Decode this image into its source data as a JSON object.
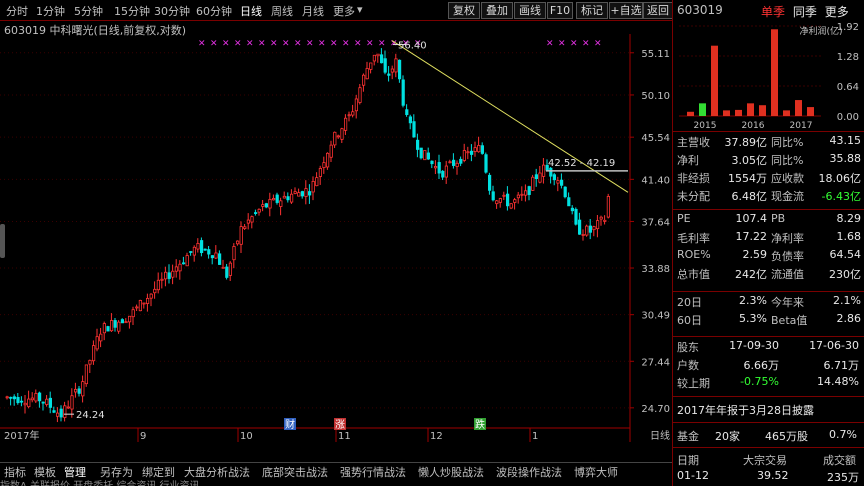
{
  "toolbar": {
    "periods": [
      "分时",
      "1分钟",
      "5分钟",
      "15分钟",
      "30分钟",
      "60分钟",
      "日线",
      "周线",
      "月线",
      "更多"
    ],
    "active_period": "日线",
    "buttons": [
      "复权",
      "叠加",
      "画线",
      "F10",
      "标记",
      "+自选",
      "返回"
    ]
  },
  "stock": {
    "title": "603019 中科曙光(日线,前复权,对数)"
  },
  "chart": {
    "y_labels": [
      "55.11",
      "50.10",
      "45.54",
      "41.40",
      "37.64",
      "33.88",
      "30.49",
      "27.44",
      "24.70"
    ],
    "x_labels": [
      "2017年",
      "9",
      "10",
      "11",
      "12",
      "1"
    ],
    "annotations": {
      "high": "56.40",
      "low": "24.24",
      "range": "42.52 - 42.19"
    },
    "markers": [
      {
        "text": "财",
        "color": "#3060c0"
      },
      {
        "text": "涨",
        "color": "#c03030"
      },
      {
        "text": "跌",
        "color": "#30a030"
      }
    ],
    "corner_label": "日线",
    "up_color": "#ff3232",
    "down_color": "#00e0e0",
    "trend_color": "#e0e060"
  },
  "bottom_tabs": [
    "指标",
    "模板",
    "管理",
    "另存为",
    "绑定到",
    "大盘分析战法",
    "底部突击战法",
    "强势行情战法",
    "懒人炒股战法",
    "波段操作战法",
    "博弈大师"
  ],
  "active_tab": "管理",
  "bottom_row2": "指数A 关联报价 开盘委托 综合资讯 行业资讯",
  "panel": {
    "code": "603019",
    "tabs": [
      "单季",
      "同季",
      "更多"
    ],
    "legend": "净利润(亿)",
    "bar_y": [
      "1.92",
      "1.28",
      "0.64",
      "0.00"
    ],
    "years": [
      "2015",
      "2016",
      "2017"
    ],
    "bars": [
      {
        "v": 0.09,
        "c": "#e03020"
      },
      {
        "v": 0.27,
        "c": "#33dd33"
      },
      {
        "v": 1.5,
        "c": "#e03020"
      },
      {
        "v": 0.12,
        "c": "#e03020"
      },
      {
        "v": 0.13,
        "c": "#e03020"
      },
      {
        "v": 0.27,
        "c": "#e03020"
      },
      {
        "v": 0.23,
        "c": "#e03020"
      },
      {
        "v": 1.85,
        "c": "#e03020"
      },
      {
        "v": 0.12,
        "c": "#e03020"
      },
      {
        "v": 0.34,
        "c": "#e03020"
      },
      {
        "v": 0.19,
        "c": "#e03020"
      }
    ],
    "fin_rows": [
      {
        "l1": "主营收",
        "v1": "37.89亿",
        "l2": "同比%",
        "v2": "43.15"
      },
      {
        "l1": "净利",
        "v1": "3.05亿",
        "l2": "同比%",
        "v2": "35.88"
      },
      {
        "l1": "非经损",
        "v1": "1554万",
        "l2": "应收款",
        "v2": "18.06亿"
      },
      {
        "l1": "未分配",
        "v1": "6.48亿",
        "l2": "现金流",
        "v2": "-6.43亿"
      }
    ],
    "val_rows": [
      {
        "l1": "PE",
        "v1": "107.4",
        "l2": "PB",
        "v2": "8.29"
      },
      {
        "l1": "毛利率",
        "v1": "17.22",
        "l2": "净利率",
        "v2": "1.68"
      },
      {
        "l1": "ROE%",
        "v1": "2.59",
        "l2": "负债率",
        "v2": "64.54"
      },
      {
        "l1": "总市值",
        "v1": "242亿",
        "l2": "流通值",
        "v2": "230亿"
      }
    ],
    "perf_rows": [
      {
        "l1": "20日",
        "v1": "2.3%",
        "l2": "今年来",
        "v2": "2.1%"
      },
      {
        "l1": "60日",
        "v1": "5.3%",
        "l2": "Beta值",
        "v2": "2.86"
      }
    ],
    "holder_rows": [
      {
        "l1": "股东",
        "v1": "17-09-30",
        "v2": "17-06-30"
      },
      {
        "l1": "户数",
        "v1": "6.66万",
        "v2": "6.71万"
      },
      {
        "l1": "较上期",
        "v1": "-0.75%",
        "v2": "14.48%"
      }
    ],
    "notice": "2017年年报于3月28日披露",
    "fund": {
      "label": "基金",
      "count": "20家",
      "shares": "465万股",
      "pct": "0.7%"
    },
    "block": {
      "headers": [
        "日期",
        "大宗交易",
        "成交额"
      ],
      "row": [
        "01-12",
        "39.52",
        "235万"
      ]
    }
  }
}
